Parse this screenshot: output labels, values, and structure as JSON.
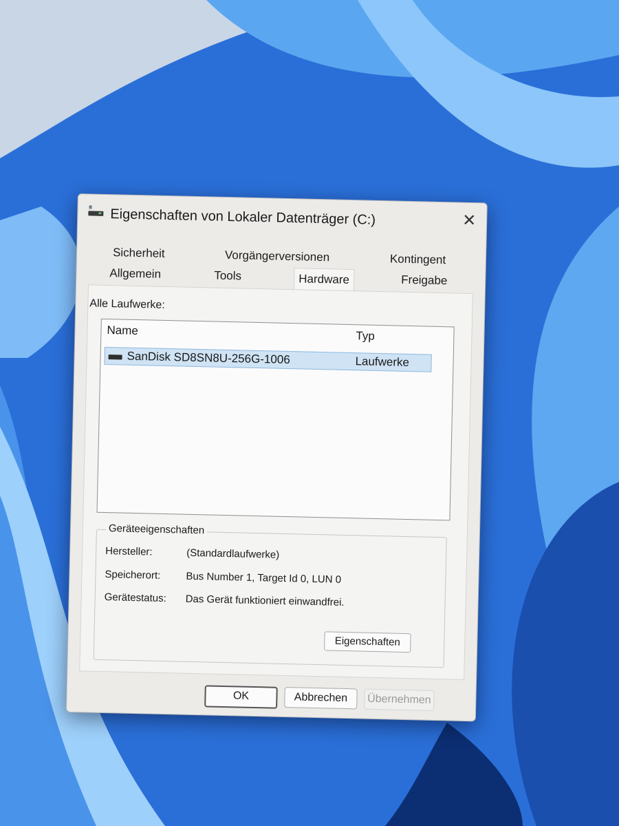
{
  "window": {
    "title": "Eigenschaften von Lokaler Datenträger (C:)",
    "close_glyph": "✕"
  },
  "tabs": {
    "row1": [
      "Sicherheit",
      "Vorgängerversionen",
      "Kontingent"
    ],
    "row2": [
      "Allgemein",
      "Tools",
      "Hardware",
      "Freigabe"
    ],
    "active": "Hardware"
  },
  "drives": {
    "label": "Alle Laufwerke:",
    "columns": [
      "Name",
      "Typ"
    ],
    "rows": [
      {
        "name": "SanDisk SD8SN8U-256G-1006",
        "type": "Laufwerke",
        "icon": "drive-icon",
        "selected": true
      }
    ]
  },
  "device_props": {
    "title": "Geräteeigenschaften",
    "rows": [
      {
        "label": "Hersteller:",
        "value": "(Standardlaufwerke)"
      },
      {
        "label": "Speicherort:",
        "value": "Bus Number 1, Target Id 0, LUN 0"
      },
      {
        "label": "Gerätestatus:",
        "value": "Das Gerät funktioniert einwandfrei."
      }
    ],
    "button": "Eigenschaften"
  },
  "footer": {
    "ok": "OK",
    "cancel": "Abbrechen",
    "apply": "Übernehmen"
  },
  "colors": {
    "wallpaper": "#1f5fc9",
    "selection": "#cfe3f4",
    "dialog_bg": "#ecebe8"
  }
}
